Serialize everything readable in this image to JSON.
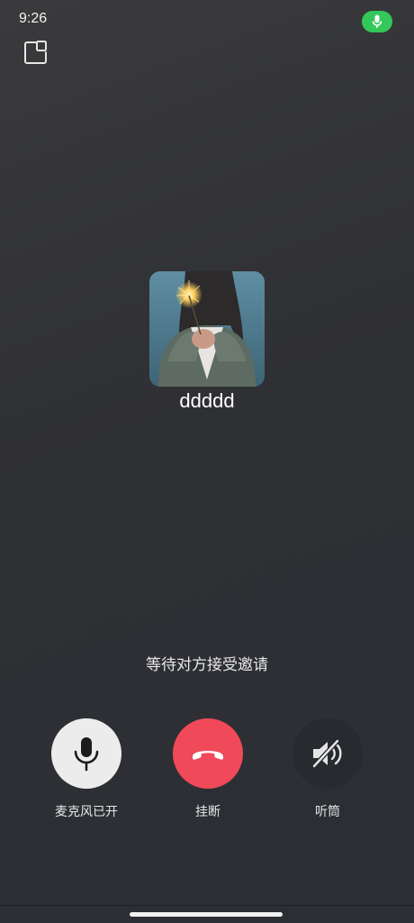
{
  "status_bar": {
    "time": "9:26",
    "mic_indicator_icon": "microphone-icon",
    "mic_indicator_color": "#34c759"
  },
  "top_bar": {
    "minimize_icon": "picture-in-picture-icon"
  },
  "callee": {
    "name": "ddddd",
    "avatar_description": "photo-avatar"
  },
  "call_status": "等待对方接受邀请",
  "controls": {
    "mic": {
      "label": "麦克风已开",
      "icon": "microphone-icon"
    },
    "hangup": {
      "label": "挂断",
      "icon": "phone-hangup-icon",
      "color": "#f0495a"
    },
    "speaker": {
      "label": "听筒",
      "icon": "speaker-off-icon"
    }
  }
}
